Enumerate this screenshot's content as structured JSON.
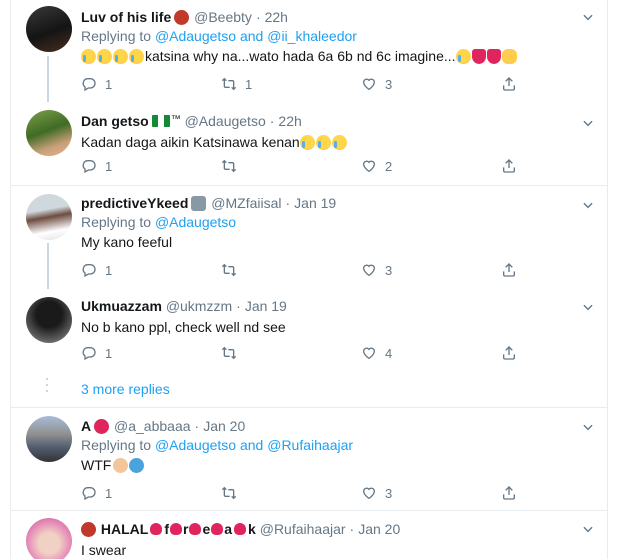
{
  "colors": {
    "accent": "#1da1f2",
    "muted": "#657786",
    "text": "#14171a",
    "border": "#e6ecf0"
  },
  "icons": {
    "reply": "reply-icon",
    "retweet": "retweet-icon",
    "like": "like-icon",
    "share": "share-icon",
    "more": "chevron-down-icon"
  },
  "tweets": [
    {
      "name": "Luv of his life",
      "handle": "@Beebty",
      "time": "22h",
      "replying_prefix": "Replying to",
      "replying_to": [
        "@Adaugetso",
        "@ii_khaleedor"
      ],
      "replying_join": "and",
      "text": "katsina why na...wato hada 6a 6b nd 6c imagine...",
      "replies": "1",
      "retweets": "1",
      "likes": "3"
    },
    {
      "name": "Dan getso",
      "handle": "@Adaugetso",
      "time": "22h",
      "text": "Kadan daga aikin Katsinawa kenan",
      "replies": "1",
      "retweets": "",
      "likes": "2"
    },
    {
      "name": "predictiveYkeed",
      "handle": "@MZfaiisal",
      "time": "Jan 19",
      "replying_prefix": "Replying to",
      "replying_to": [
        "@Adaugetso"
      ],
      "text": "My kano feeful",
      "replies": "1",
      "retweets": "",
      "likes": "3"
    },
    {
      "name": "Ukmuazzam",
      "handle": "@ukmzzm",
      "time": "Jan 19",
      "text": "No b kano ppl, check well nd see",
      "replies": "1",
      "retweets": "",
      "likes": "4"
    },
    {
      "name": "A",
      "handle": "@a_abbaaa",
      "time": "Jan 20",
      "replying_prefix": "Replying to",
      "replying_to": [
        "@Adaugetso",
        "@Rufaihaajar"
      ],
      "replying_join": "and",
      "text": "WTF",
      "replies": "1",
      "retweets": "",
      "likes": "3"
    },
    {
      "name_parts": [
        "HALAL",
        "f",
        "r",
        "e",
        "a",
        "k"
      ],
      "handle": "@Rufaihaajar",
      "time": "Jan 20",
      "text": "I swear"
    }
  ],
  "more_replies": "3 more replies",
  "separator": "·"
}
